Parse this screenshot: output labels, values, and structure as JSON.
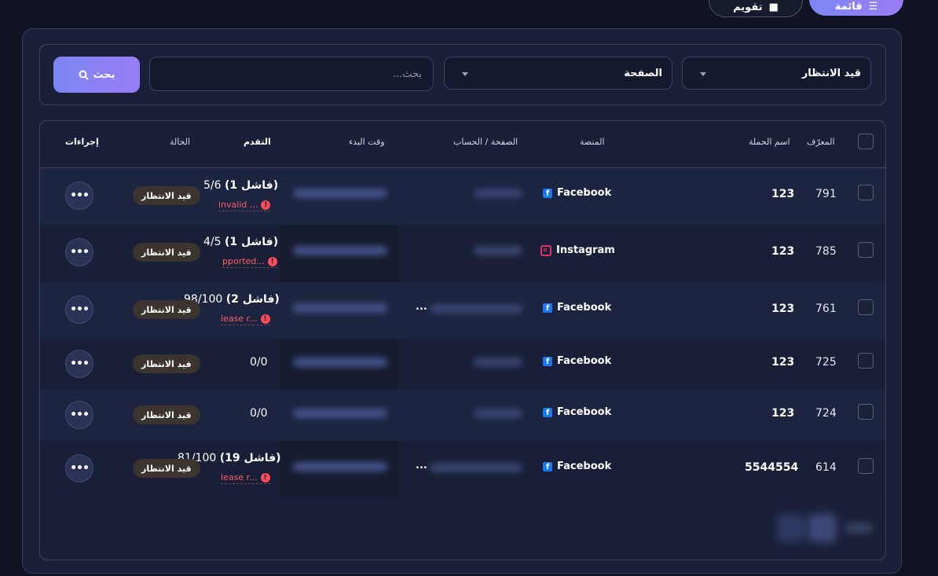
{
  "top_buttons": {
    "list_label": "قائمة",
    "calendar_label": "تقويم"
  },
  "filters": {
    "status_value": "قيد الانتظار",
    "page_value": "الصفحة",
    "search_placeholder": "بحث...",
    "search_button": "بحث"
  },
  "table": {
    "headers": {
      "id": "المعرّف",
      "campaign_name": "اسم الحملة",
      "platform": "المنصة",
      "page_account": "الصفحة / الحساب",
      "start_time": "وقت البدء",
      "progress": "التقدم",
      "status": "الحالة",
      "actions": "إجراءات"
    },
    "rows": [
      {
        "id": "791",
        "name": "123",
        "platform": "Facebook",
        "progress_main": "5/6",
        "progress_fail": "(1 فاشل)",
        "error": "invalid ...",
        "status": "قيد الانتظار"
      },
      {
        "id": "785",
        "name": "123",
        "platform": "Instagram",
        "progress_main": "4/5",
        "progress_fail": "(1 فاشل)",
        "error": "pported...",
        "status": "قيد الانتظار"
      },
      {
        "id": "761",
        "name": "123",
        "platform": "Facebook",
        "progress_main": "98/100",
        "progress_fail": "(2 فاشل)",
        "error": "lease r...",
        "status": "قيد الانتظار",
        "page_more": "..."
      },
      {
        "id": "725",
        "name": "123",
        "platform": "Facebook",
        "progress_main": "0/0",
        "status": "قيد الانتظار"
      },
      {
        "id": "724",
        "name": "123",
        "platform": "Facebook",
        "progress_main": "0/0",
        "status": "قيد الانتظار"
      },
      {
        "id": "614",
        "name": "5544554",
        "platform": "Facebook",
        "progress_main": "81/100",
        "progress_fail": "(19 فاشل)",
        "error": "lease r...",
        "status": "قيد الانتظار",
        "page_more": "..."
      }
    ],
    "action_label": "•••"
  },
  "colors": {
    "accent": "#7b86f5",
    "badge_bg": "#3b342f",
    "error": "#ff5a6a",
    "facebook": "#1877f2",
    "instagram": "#e1306c"
  }
}
